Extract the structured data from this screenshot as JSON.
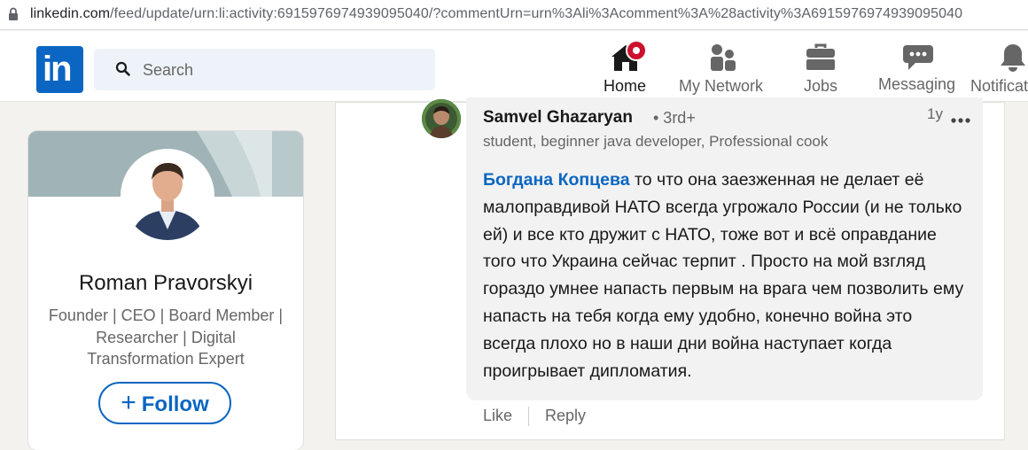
{
  "browser": {
    "url_host": "linkedin.com",
    "url_rest": "/feed/update/urn:li:activity:6915976974939095040/?commentUrn=urn%3Ali%3Acomment%3A%28activity%3A6915976974939095040"
  },
  "navbar": {
    "logo_text": "in",
    "search_placeholder": "Search",
    "items": [
      {
        "label": "Home",
        "icon": "home-icon",
        "active": true
      },
      {
        "label": "My Network",
        "icon": "network-icon",
        "active": false
      },
      {
        "label": "Jobs",
        "icon": "briefcase-icon",
        "active": false
      },
      {
        "label": "Messaging",
        "icon": "message-icon",
        "active": false
      },
      {
        "label": "Notifications",
        "icon": "bell-icon",
        "active": false
      }
    ]
  },
  "profile": {
    "name": "Roman Pravorskyi",
    "headline": "Founder | CEO | Board Member | Researcher | Digital Transformation Expert",
    "follow_label": "Follow",
    "follow_plus": "+"
  },
  "comment": {
    "author": "Samvel Ghazaryan",
    "degree": "• 3rd+",
    "headline": "student, beginner java developer, Professional cook",
    "time": "1y",
    "mention": "Богдана Копцева",
    "text": " то что она заезженная не делает её малоправдивой НАТО всегда угрожало России (и не только ей) и все кто дружит с НАТО, тоже вот и всё оправдание того что Украина сейчас терпит . Просто на мой взгляд гораздо умнее напасть первым на врага чем позволить ему напасть на тебя когда ему удобно, конечно война это всегда плохо но в наши дни война наступает когда проигрывает дипломатия.",
    "like_label": "Like",
    "reply_label": "Reply"
  },
  "colors": {
    "brand": "#0a66c2",
    "badge": "#cb112d",
    "page_bg": "#f4f2ee"
  }
}
